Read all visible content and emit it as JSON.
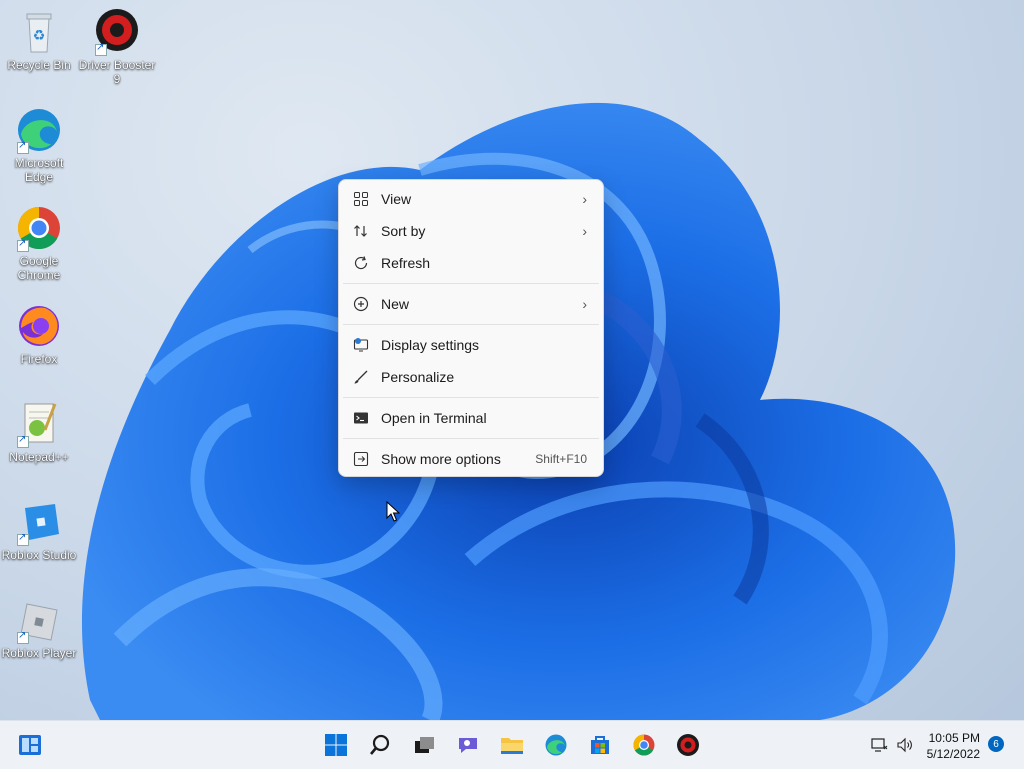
{
  "desktop": {
    "icons": [
      {
        "label": "Recycle Bin"
      },
      {
        "label": "Driver Booster 9"
      },
      {
        "label": "Microsoft Edge"
      },
      {
        "label": "Google Chrome"
      },
      {
        "label": "Firefox"
      },
      {
        "label": "Notepad++"
      },
      {
        "label": "Roblox Studio"
      },
      {
        "label": "Roblox Player"
      }
    ]
  },
  "context_menu": {
    "items": [
      {
        "label": "View",
        "icon": "view-grid-icon",
        "submenu": true
      },
      {
        "label": "Sort by",
        "icon": "sort-icon",
        "submenu": true
      },
      {
        "label": "Refresh",
        "icon": "refresh-icon"
      },
      {
        "label": "New",
        "icon": "new-plus-icon",
        "submenu": true
      },
      {
        "label": "Display settings",
        "icon": "display-settings-icon"
      },
      {
        "label": "Personalize",
        "icon": "brush-icon"
      },
      {
        "label": "Open in Terminal",
        "icon": "terminal-icon"
      },
      {
        "label": "Show more options",
        "icon": "more-options-icon",
        "shortcut": "Shift+F10"
      }
    ]
  },
  "taskbar": {
    "apps": [
      "Start",
      "Search",
      "Task View",
      "Chat",
      "File Explorer",
      "Microsoft Edge",
      "Microsoft Store",
      "Google Chrome",
      "Driver Booster"
    ],
    "time": "10:05 PM",
    "date": "5/12/2022",
    "notification_count": "6"
  },
  "colors": {
    "accent": "#0067c0",
    "bloom": "#1d6fe0",
    "menu_bg": "#f9f9f9"
  }
}
